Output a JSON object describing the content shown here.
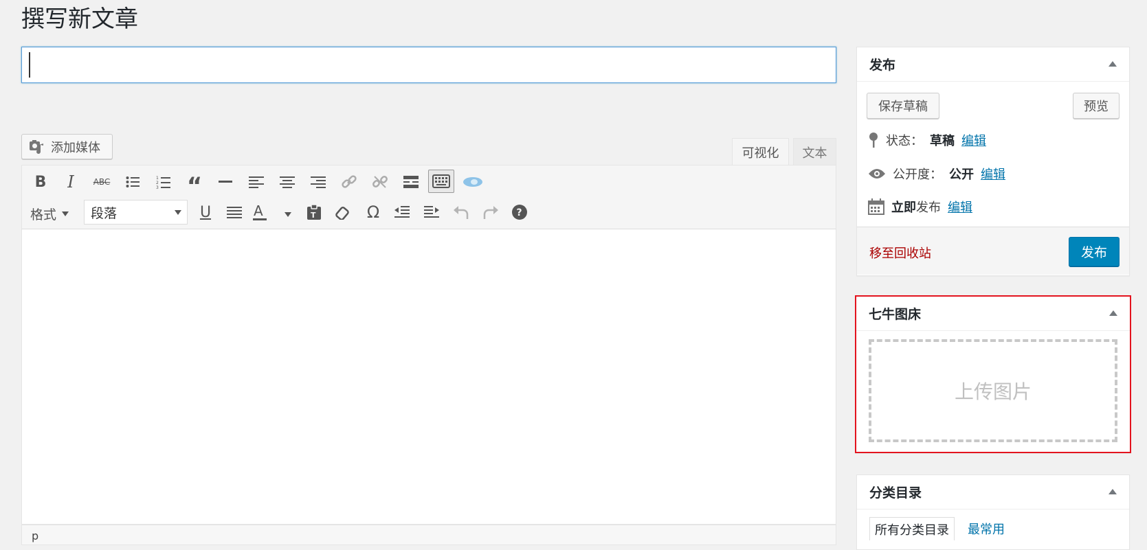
{
  "page": {
    "title": "撰写新文章"
  },
  "editor": {
    "title_value": "",
    "add_media": "添加媒体",
    "tabs": [
      "可视化",
      "文本"
    ],
    "format_label": "格式",
    "paragraph_select": "段落",
    "status_path": "p"
  },
  "publish": {
    "header": "发布",
    "save_draft": "保存草稿",
    "preview": "预览",
    "status_label": "状态：",
    "status_value": "草稿",
    "visibility_label": "公开度：",
    "visibility_value": "公开",
    "schedule_bold": "立即",
    "schedule_text": "发布",
    "edit_link": "编辑",
    "trash": "移至回收站",
    "publish_btn": "发布"
  },
  "qiniu": {
    "header": "七牛图床",
    "upload": "上传图片"
  },
  "categories": {
    "header": "分类目录",
    "tab_all": "所有分类目录",
    "tab_common": "最常用"
  },
  "colors": {
    "accent": "#0085ba",
    "link": "#0073aa",
    "trash": "#a00000",
    "highlight_border": "#e3131e"
  }
}
